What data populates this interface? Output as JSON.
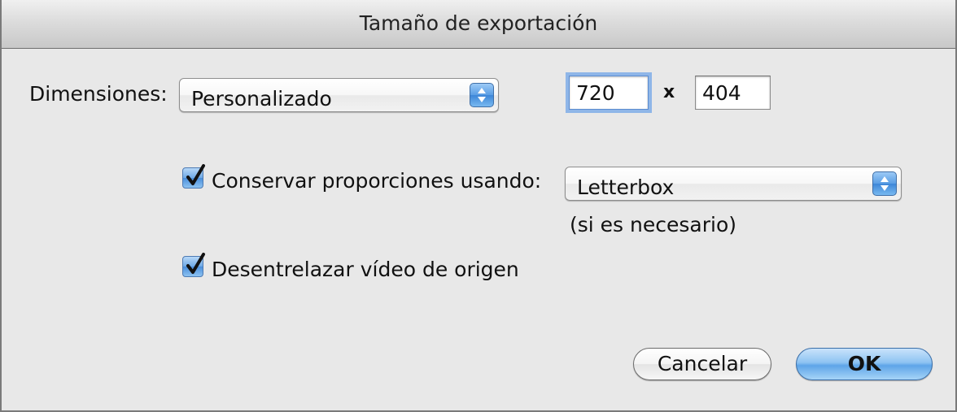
{
  "window": {
    "title": "Tamaño de exportación"
  },
  "dimensions": {
    "label": "Dimensiones:",
    "selected": "Personalizado",
    "width_value": "720",
    "times_symbol": "x",
    "height_value": "404"
  },
  "preserve_aspect": {
    "checked": true,
    "label": "Conservar proporciones usando:",
    "selected": "Letterbox",
    "note": "(si es necesario)"
  },
  "deinterlace": {
    "checked": true,
    "label": "Desentrelazar vídeo de origen"
  },
  "buttons": {
    "cancel": "Cancelar",
    "ok": "OK"
  },
  "colors": {
    "accent": "#5ea5e8",
    "window_bg": "#e8e8e8"
  }
}
